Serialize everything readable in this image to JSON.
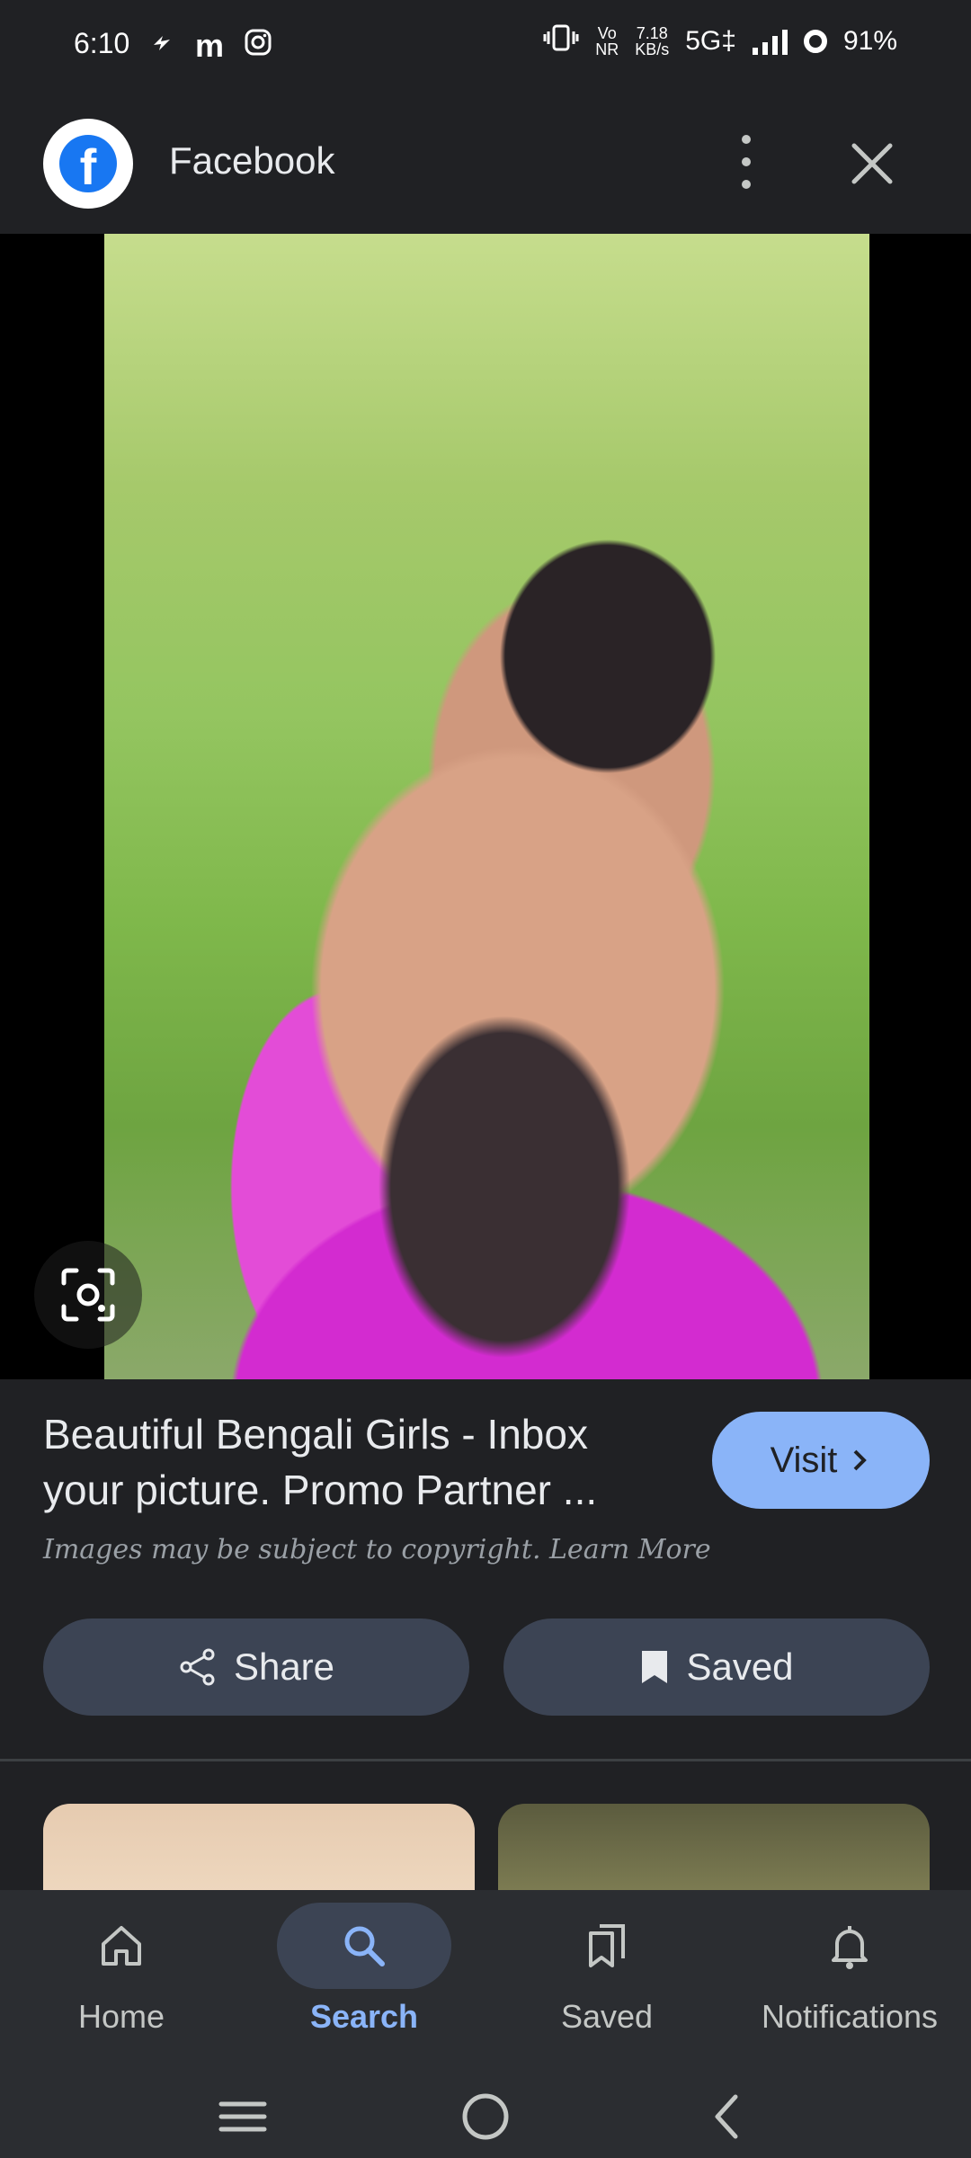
{
  "status_bar": {
    "time": "6:10",
    "network_label_top": "Vo",
    "network_label_bottom": "NR",
    "speed_top": "7.18",
    "speed_bottom": "KB/s",
    "network_type": "5G‡",
    "battery": "91%",
    "icons": [
      "flash-icon",
      "m-app-icon",
      "instagram-icon",
      "vibrate-icon",
      "signal-icon",
      "battery-icon"
    ]
  },
  "top_bar": {
    "source_name": "Facebook",
    "icons": [
      "facebook-logo",
      "more-options-icon",
      "close-icon"
    ]
  },
  "result": {
    "title": "Beautiful Bengali Girls - Inbox your picture. Promo Partner ...",
    "copyright_text": "Images may be subject to copyright. Learn More",
    "visit_label": "Visit",
    "share_label": "Share",
    "saved_label": "Saved"
  },
  "bottom_nav": {
    "items": [
      {
        "label": "Home",
        "icon": "home-icon",
        "active": false
      },
      {
        "label": "Search",
        "icon": "search-icon",
        "active": true
      },
      {
        "label": "Saved",
        "icon": "saved-icon",
        "active": false
      },
      {
        "label": "Notifications",
        "icon": "bell-icon",
        "active": false
      }
    ]
  },
  "colors": {
    "background": "#202124",
    "accent": "#8ab4f8",
    "button_bg": "#3c4454",
    "facebook_blue": "#1877f2"
  }
}
